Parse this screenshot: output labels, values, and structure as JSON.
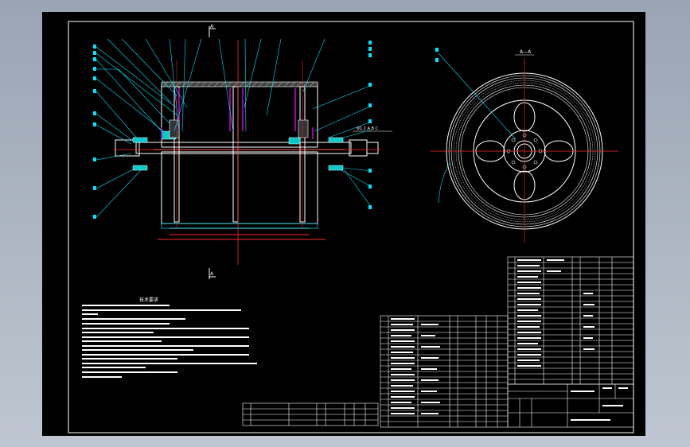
{
  "drawing": {
    "section_top_label": "A",
    "section_bottom_label": "A",
    "section_view_label": "A—A",
    "shaft_note": "Φ1.1 A B C"
  },
  "colors": {
    "background": "#000000",
    "frame": "#ffffff",
    "geometry": "#ffffff",
    "leaders": "#00e5ff",
    "centerline": "#ff2a2a",
    "dimension": "#ff2a2a",
    "bearing": "#00c8c8",
    "bolts": "#e600e6",
    "table_lines": "#ffffff"
  },
  "tech_notes": {
    "title": "技术要求"
  }
}
